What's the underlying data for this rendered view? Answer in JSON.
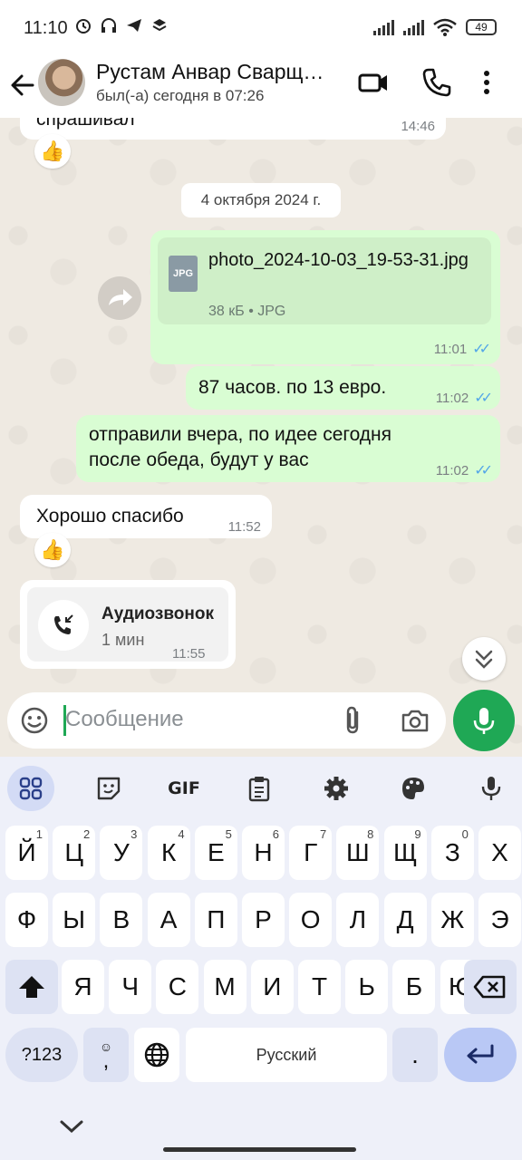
{
  "status_bar": {
    "time": "11:10",
    "battery": "49"
  },
  "header": {
    "contact_name": "Рустам Анвар Сварщ…",
    "contact_status": "был(-а) сегодня в 07:26"
  },
  "chat": {
    "partial_message": {
      "text": "спрашивал",
      "time": "14:46",
      "reaction": "👍"
    },
    "date_chip": "4 октября 2024 г.",
    "file_message": {
      "filename": "photo_2024-10-03_19-53-31.jpg",
      "file_meta": "38 кБ • JPG",
      "file_icon_label": "JPG",
      "time": "11:01"
    },
    "messages": [
      {
        "text": "87 часов. по 13 евро.",
        "time": "11:02",
        "direction": "out"
      },
      {
        "text": "отправили вчера, по идее сегодня после обеда, будут у вас",
        "time": "11:02",
        "direction": "out"
      },
      {
        "text": "Хорошо спасибо",
        "time": "11:52",
        "direction": "in",
        "reaction": "👍"
      }
    ],
    "call": {
      "title": "Аудиозвонок",
      "duration": "1 мин",
      "time": "11:55"
    }
  },
  "composer": {
    "placeholder": "Сообщение"
  },
  "keyboard": {
    "toolbar": [
      "apps-icon",
      "sticker-icon",
      "GIF",
      "clipboard-icon",
      "gear-icon",
      "palette-icon",
      "mic-icon"
    ],
    "gif_label": "GIF",
    "row1": [
      {
        "k": "Й",
        "h": "1"
      },
      {
        "k": "Ц",
        "h": "2"
      },
      {
        "k": "У",
        "h": "3"
      },
      {
        "k": "К",
        "h": "4"
      },
      {
        "k": "Е",
        "h": "5"
      },
      {
        "k": "Н",
        "h": "6"
      },
      {
        "k": "Г",
        "h": "7"
      },
      {
        "k": "Ш",
        "h": "8"
      },
      {
        "k": "Щ",
        "h": "9"
      },
      {
        "k": "З",
        "h": "0"
      },
      {
        "k": "Х",
        "h": ""
      }
    ],
    "row2": [
      "Ф",
      "Ы",
      "В",
      "А",
      "П",
      "Р",
      "О",
      "Л",
      "Д",
      "Ж",
      "Э"
    ],
    "row3": [
      "Я",
      "Ч",
      "С",
      "М",
      "И",
      "Т",
      "Ь",
      "Б",
      "Ю"
    ],
    "symbols_key": "?123",
    "comma_key": ",",
    "emoji_hint": "☺",
    "space_label": "Русский",
    "period_key": "."
  },
  "colors": {
    "outgoing_bubble": "#d9fdd3",
    "incoming_bubble": "#ffffff",
    "accent_green": "#1fa855",
    "read_ticks": "#53a6e8"
  }
}
